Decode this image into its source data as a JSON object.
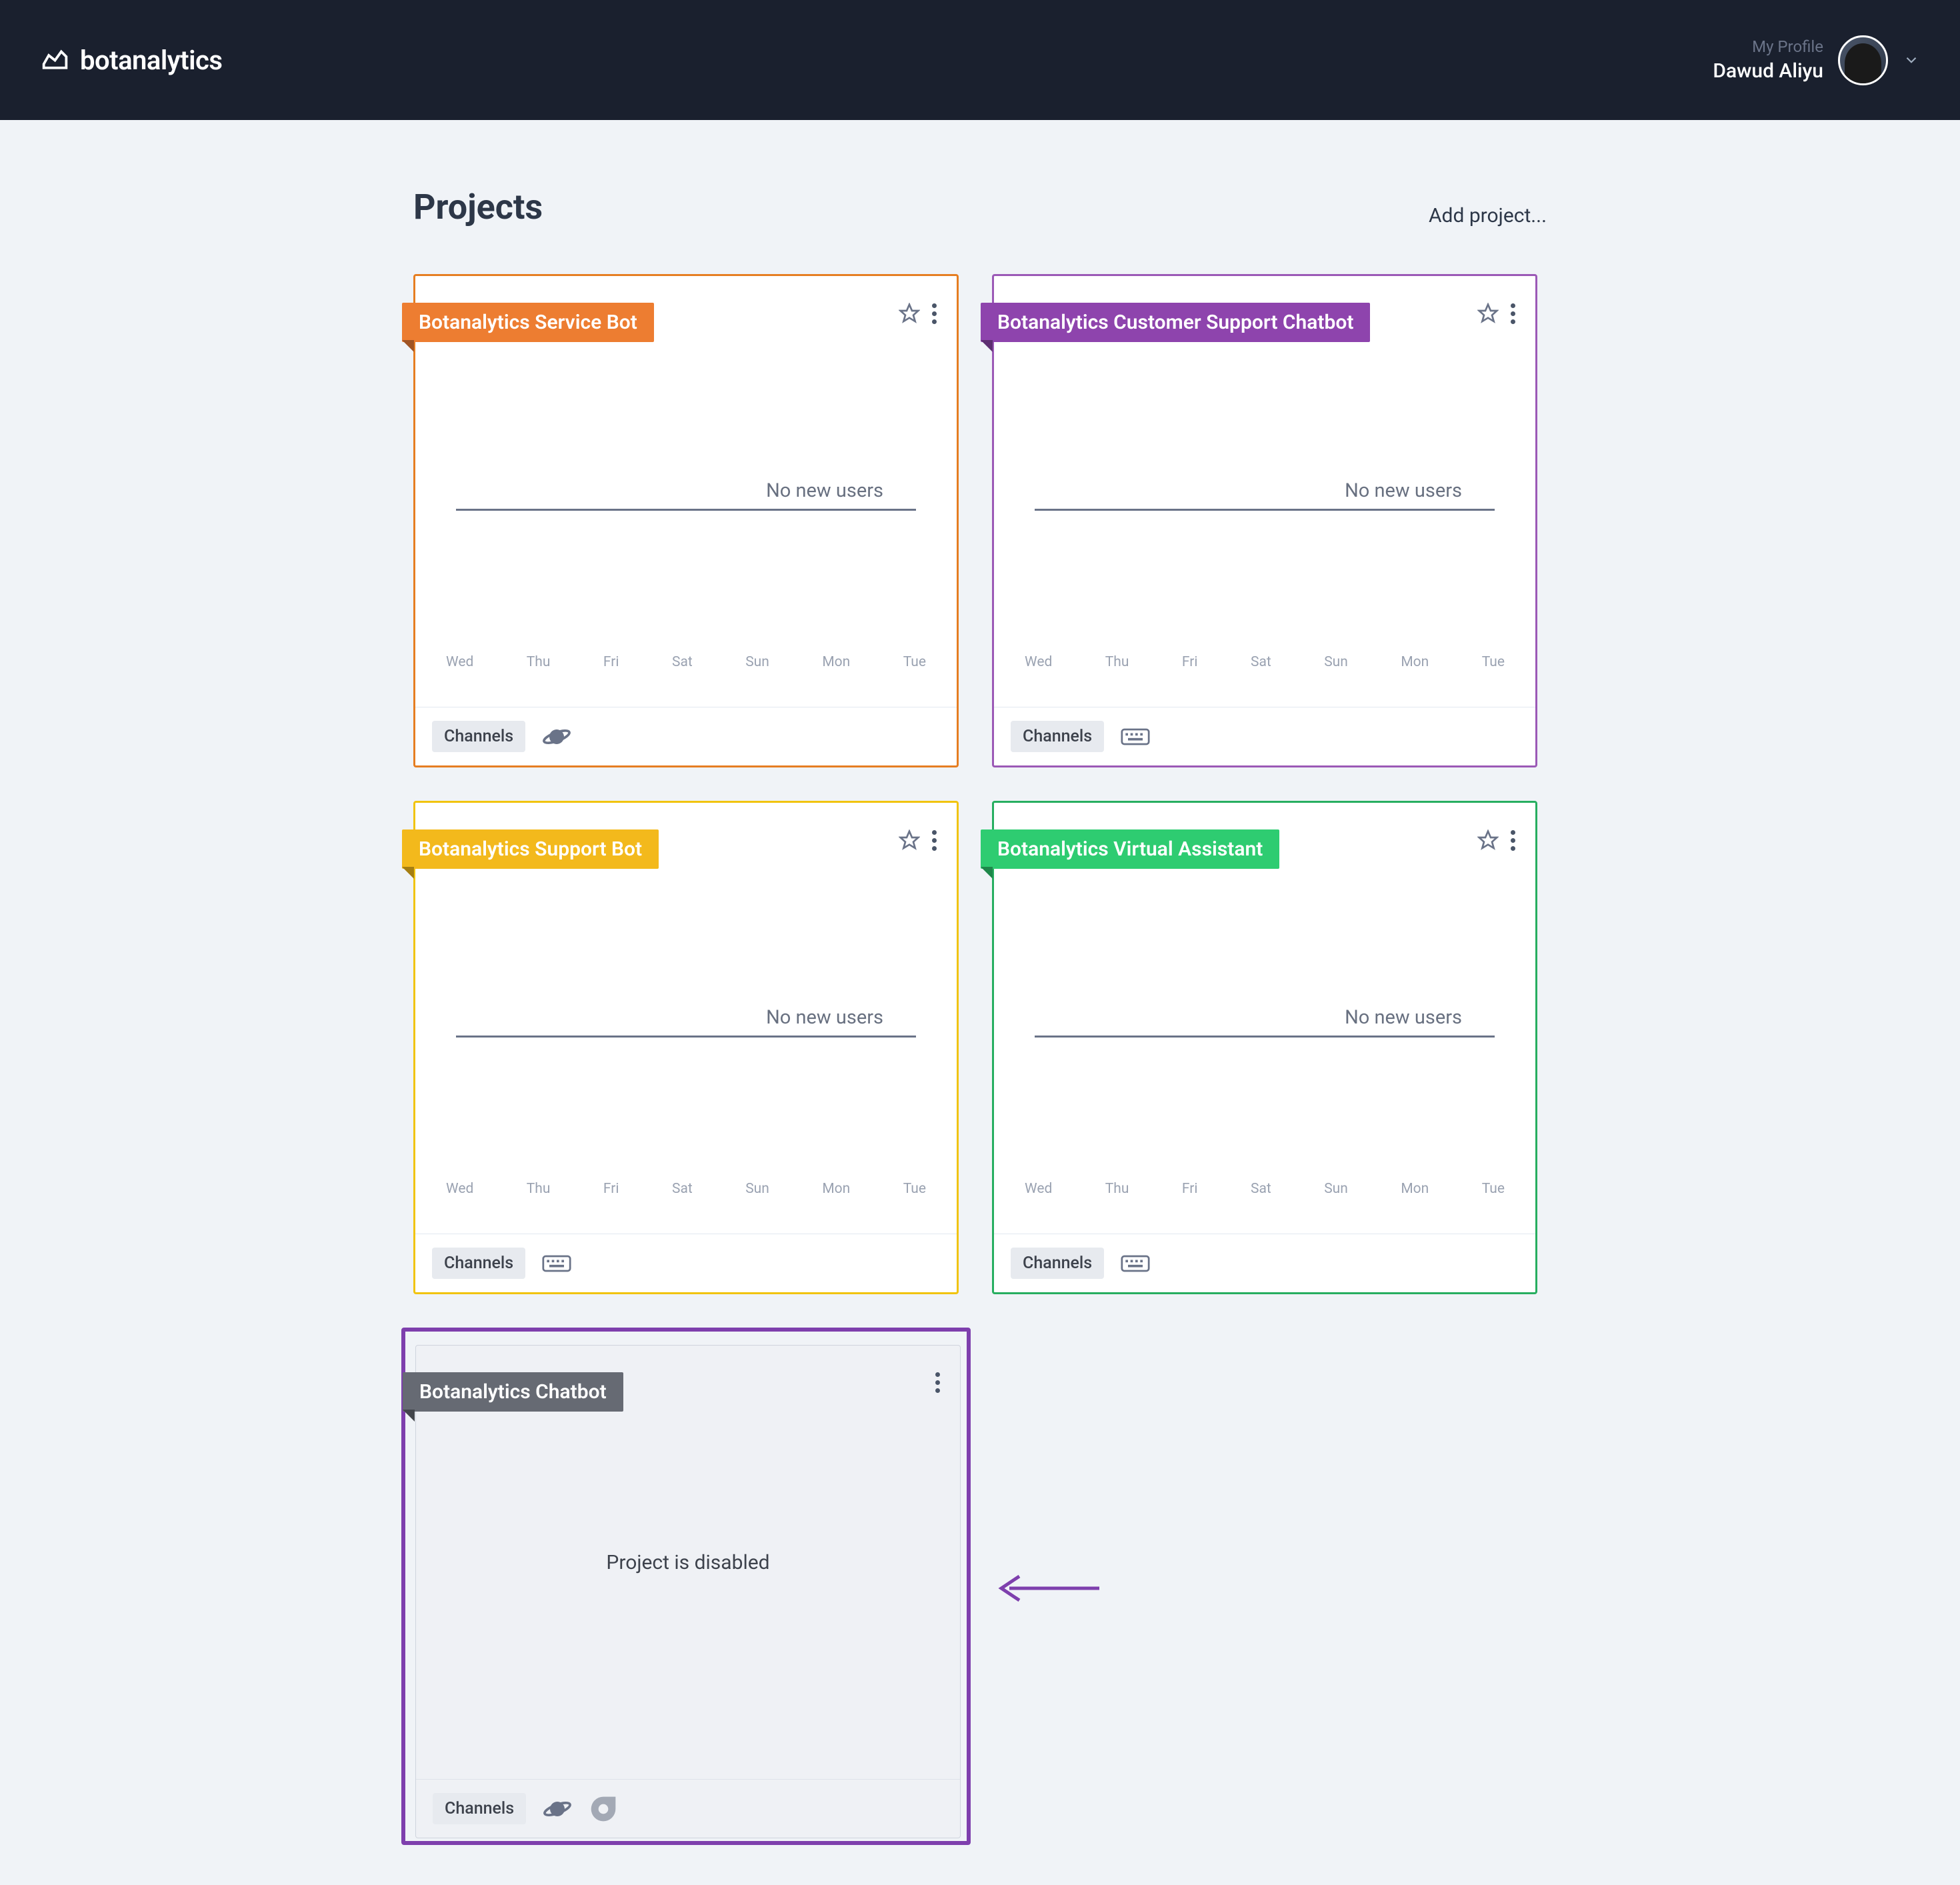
{
  "header": {
    "logo_text": "botanalytics",
    "profile_label": "My Profile",
    "profile_name": "Dawud Aliyu"
  },
  "page": {
    "title": "Projects",
    "add_project": "Add project..."
  },
  "days": [
    "Wed",
    "Thu",
    "Fri",
    "Sat",
    "Sun",
    "Mon",
    "Tue"
  ],
  "no_new": "No new users",
  "channels_label": "Channels",
  "disabled_text": "Project is disabled",
  "projects": [
    {
      "name": "Botanalytics Service Bot",
      "color": "orange",
      "channel_icon": "planet"
    },
    {
      "name": "Botanalytics Customer Support Chatbot",
      "color": "purple",
      "channel_icon": "keyboard"
    },
    {
      "name": "Botanalytics Support Bot",
      "color": "yellow",
      "channel_icon": "keyboard"
    },
    {
      "name": "Botanalytics Virtual Assistant",
      "color": "green",
      "channel_icon": "keyboard"
    },
    {
      "name": "Botanalytics Chatbot",
      "color": "gray",
      "disabled": true,
      "channel_icons": [
        "planet",
        "bot"
      ]
    }
  ]
}
